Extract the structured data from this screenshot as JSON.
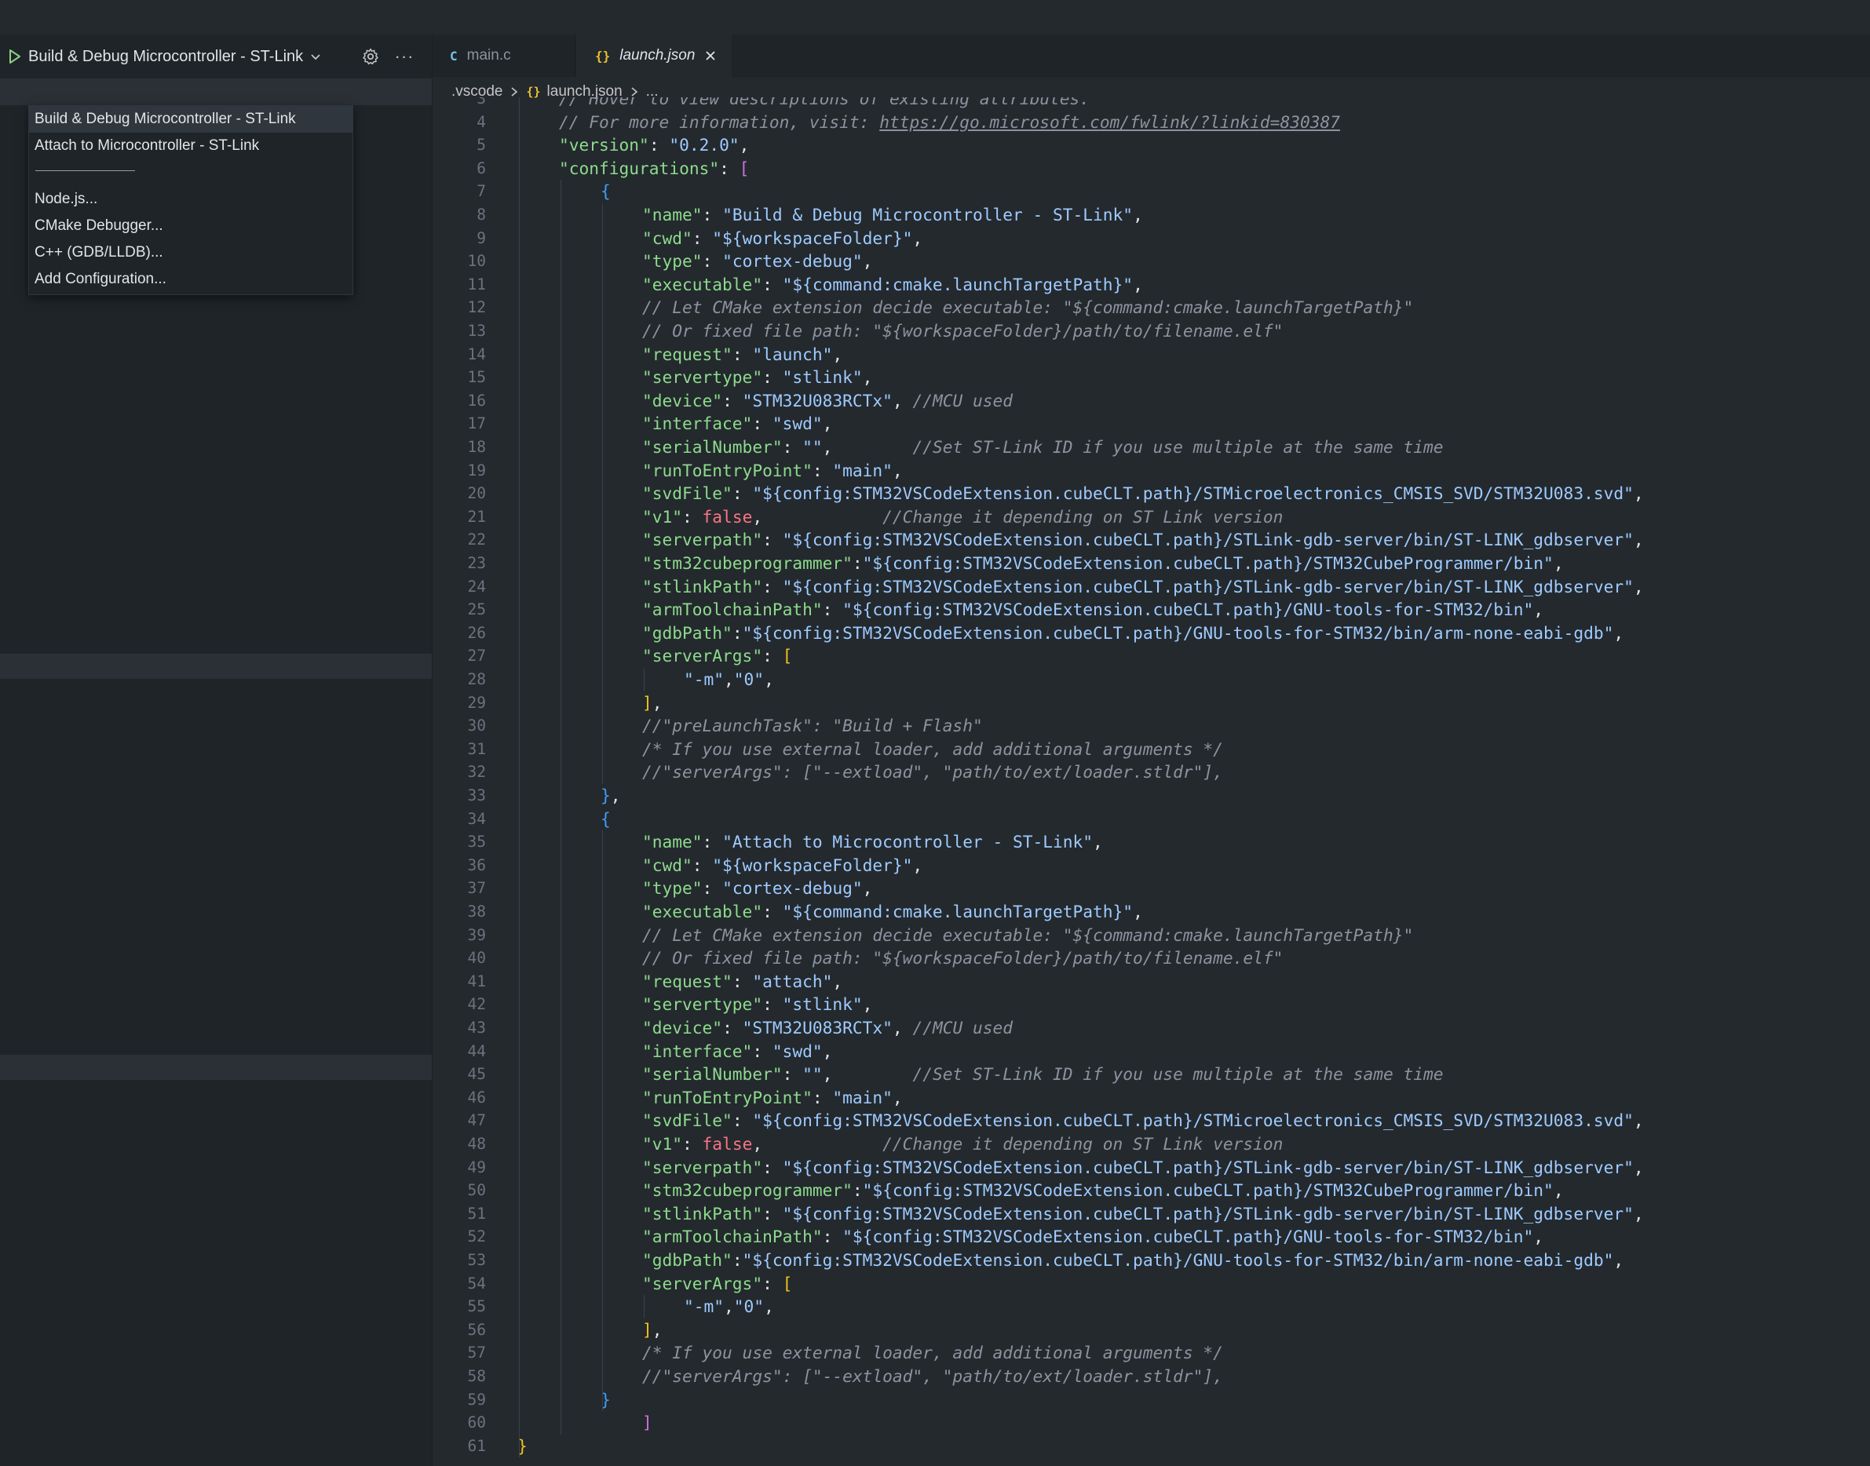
{
  "debug_toolbar": {
    "selected_config": "Build & Debug Microcontroller - ST-Link"
  },
  "config_dropdown": {
    "items": [
      "Build & Debug Microcontroller - ST-Link",
      "Attach to Microcontroller - ST-Link",
      "Node.js...",
      "CMake Debugger...",
      "C++ (GDB/LLDB)...",
      "Add Configuration..."
    ]
  },
  "tabs": [
    {
      "icon": "C",
      "label": "main.c",
      "active": false
    },
    {
      "icon": "{}",
      "label": "launch.json",
      "active": true
    }
  ],
  "breadcrumb": [
    ".vscode",
    "launch.json",
    "..."
  ],
  "breadcrumb_icon": "{}",
  "code": {
    "first_line_number": 3,
    "lines": [
      [
        [
          "c",
          "// Hover to view descriptions of existing attributes."
        ]
      ],
      [
        [
          "c",
          "// For more information, visit: "
        ],
        [
          "cu",
          "https://go.microsoft.com/fwlink/?linkid=830387"
        ]
      ],
      [
        [
          "k",
          "\"version\""
        ],
        [
          "p",
          ": "
        ],
        [
          "s",
          "\"0.2.0\""
        ],
        [
          "p",
          ","
        ]
      ],
      [
        [
          "k",
          "\"configurations\""
        ],
        [
          "p",
          ": "
        ],
        [
          "b2",
          "["
        ]
      ],
      [
        [
          "b3",
          "{"
        ]
      ],
      [
        [
          "k",
          "\"name\""
        ],
        [
          "p",
          ": "
        ],
        [
          "s",
          "\"Build & Debug Microcontroller - ST-Link\""
        ],
        [
          "p",
          ","
        ]
      ],
      [
        [
          "k",
          "\"cwd\""
        ],
        [
          "p",
          ": "
        ],
        [
          "s",
          "\"${workspaceFolder}\""
        ],
        [
          "p",
          ","
        ]
      ],
      [
        [
          "k",
          "\"type\""
        ],
        [
          "p",
          ": "
        ],
        [
          "s",
          "\"cortex-debug\""
        ],
        [
          "p",
          ","
        ]
      ],
      [
        [
          "k",
          "\"executable\""
        ],
        [
          "p",
          ": "
        ],
        [
          "s",
          "\"${command:cmake.launchTargetPath}\""
        ],
        [
          "p",
          ","
        ]
      ],
      [
        [
          "c",
          "// Let CMake extension decide executable: \"${command:cmake.launchTargetPath}\""
        ]
      ],
      [
        [
          "c",
          "// Or fixed file path: \"${workspaceFolder}/path/to/filename.elf\""
        ]
      ],
      [
        [
          "k",
          "\"request\""
        ],
        [
          "p",
          ": "
        ],
        [
          "s",
          "\"launch\""
        ],
        [
          "p",
          ","
        ]
      ],
      [
        [
          "k",
          "\"servertype\""
        ],
        [
          "p",
          ": "
        ],
        [
          "s",
          "\"stlink\""
        ],
        [
          "p",
          ","
        ]
      ],
      [
        [
          "k",
          "\"device\""
        ],
        [
          "p",
          ": "
        ],
        [
          "s",
          "\"STM32U083RCTx\""
        ],
        [
          "p",
          ", "
        ],
        [
          "c",
          "//MCU used"
        ]
      ],
      [
        [
          "k",
          "\"interface\""
        ],
        [
          "p",
          ": "
        ],
        [
          "s",
          "\"swd\""
        ],
        [
          "p",
          ","
        ]
      ],
      [
        [
          "k",
          "\"serialNumber\""
        ],
        [
          "p",
          ": "
        ],
        [
          "s",
          "\"\""
        ],
        [
          "p",
          ",        "
        ],
        [
          "c",
          "//Set ST-Link ID if you use multiple at the same time"
        ]
      ],
      [
        [
          "k",
          "\"runToEntryPoint\""
        ],
        [
          "p",
          ": "
        ],
        [
          "s",
          "\"main\""
        ],
        [
          "p",
          ","
        ]
      ],
      [
        [
          "k",
          "\"svdFile\""
        ],
        [
          "p",
          ": "
        ],
        [
          "s",
          "\"${config:STM32VSCodeExtension.cubeCLT.path}/STMicroelectronics_CMSIS_SVD/STM32U083.svd\""
        ],
        [
          "p",
          ","
        ]
      ],
      [
        [
          "k",
          "\"v1\""
        ],
        [
          "p",
          ": "
        ],
        [
          "kw",
          "false"
        ],
        [
          "p",
          ",            "
        ],
        [
          "c",
          "//Change it depending on ST Link version"
        ]
      ],
      [
        [
          "k",
          "\"serverpath\""
        ],
        [
          "p",
          ": "
        ],
        [
          "s",
          "\"${config:STM32VSCodeExtension.cubeCLT.path}/STLink-gdb-server/bin/ST-LINK_gdbserver\""
        ],
        [
          "p",
          ","
        ]
      ],
      [
        [
          "k",
          "\"stm32cubeprogrammer\""
        ],
        [
          "p",
          ":"
        ],
        [
          "s",
          "\"${config:STM32VSCodeExtension.cubeCLT.path}/STM32CubeProgrammer/bin\""
        ],
        [
          "p",
          ","
        ]
      ],
      [
        [
          "k",
          "\"stlinkPath\""
        ],
        [
          "p",
          ": "
        ],
        [
          "s",
          "\"${config:STM32VSCodeExtension.cubeCLT.path}/STLink-gdb-server/bin/ST-LINK_gdbserver\""
        ],
        [
          "p",
          ","
        ]
      ],
      [
        [
          "k",
          "\"armToolchainPath\""
        ],
        [
          "p",
          ": "
        ],
        [
          "s",
          "\"${config:STM32VSCodeExtension.cubeCLT.path}/GNU-tools-for-STM32/bin\""
        ],
        [
          "p",
          ","
        ]
      ],
      [
        [
          "k",
          "\"gdbPath\""
        ],
        [
          "p",
          ":"
        ],
        [
          "s",
          "\"${config:STM32VSCodeExtension.cubeCLT.path}/GNU-tools-for-STM32/bin/arm-none-eabi-gdb\""
        ],
        [
          "p",
          ","
        ]
      ],
      [
        [
          "k",
          "\"serverArgs\""
        ],
        [
          "p",
          ": "
        ],
        [
          "b1",
          "["
        ]
      ],
      [
        [
          "s",
          "\"-m\""
        ],
        [
          "p",
          ","
        ],
        [
          "s",
          "\"0\""
        ],
        [
          "p",
          ","
        ]
      ],
      [
        [
          "b1",
          "]"
        ],
        [
          "p",
          ","
        ]
      ],
      [
        [
          "c",
          "//\"preLaunchTask\": \"Build + Flash\""
        ]
      ],
      [
        [
          "c",
          "/* If you use external loader, add additional arguments */"
        ]
      ],
      [
        [
          "c",
          "//\"serverArgs\": [\"--extload\", \"path/to/ext/loader.stldr\"],"
        ]
      ],
      [
        [
          "b3",
          "}"
        ],
        [
          "p",
          ","
        ]
      ],
      [
        [
          "b3",
          "{"
        ]
      ],
      [
        [
          "k",
          "\"name\""
        ],
        [
          "p",
          ": "
        ],
        [
          "s",
          "\"Attach to Microcontroller - ST-Link\""
        ],
        [
          "p",
          ","
        ]
      ],
      [
        [
          "k",
          "\"cwd\""
        ],
        [
          "p",
          ": "
        ],
        [
          "s",
          "\"${workspaceFolder}\""
        ],
        [
          "p",
          ","
        ]
      ],
      [
        [
          "k",
          "\"type\""
        ],
        [
          "p",
          ": "
        ],
        [
          "s",
          "\"cortex-debug\""
        ],
        [
          "p",
          ","
        ]
      ],
      [
        [
          "k",
          "\"executable\""
        ],
        [
          "p",
          ": "
        ],
        [
          "s",
          "\"${command:cmake.launchTargetPath}\""
        ],
        [
          "p",
          ","
        ]
      ],
      [
        [
          "c",
          "// Let CMake extension decide executable: \"${command:cmake.launchTargetPath}\""
        ]
      ],
      [
        [
          "c",
          "// Or fixed file path: \"${workspaceFolder}/path/to/filename.elf\""
        ]
      ],
      [
        [
          "k",
          "\"request\""
        ],
        [
          "p",
          ": "
        ],
        [
          "s",
          "\"attach\""
        ],
        [
          "p",
          ","
        ]
      ],
      [
        [
          "k",
          "\"servertype\""
        ],
        [
          "p",
          ": "
        ],
        [
          "s",
          "\"stlink\""
        ],
        [
          "p",
          ","
        ]
      ],
      [
        [
          "k",
          "\"device\""
        ],
        [
          "p",
          ": "
        ],
        [
          "s",
          "\"STM32U083RCTx\""
        ],
        [
          "p",
          ", "
        ],
        [
          "c",
          "//MCU used"
        ]
      ],
      [
        [
          "k",
          "\"interface\""
        ],
        [
          "p",
          ": "
        ],
        [
          "s",
          "\"swd\""
        ],
        [
          "p",
          ","
        ]
      ],
      [
        [
          "k",
          "\"serialNumber\""
        ],
        [
          "p",
          ": "
        ],
        [
          "s",
          "\"\""
        ],
        [
          "p",
          ",        "
        ],
        [
          "c",
          "//Set ST-Link ID if you use multiple at the same time"
        ]
      ],
      [
        [
          "k",
          "\"runToEntryPoint\""
        ],
        [
          "p",
          ": "
        ],
        [
          "s",
          "\"main\""
        ],
        [
          "p",
          ","
        ]
      ],
      [
        [
          "k",
          "\"svdFile\""
        ],
        [
          "p",
          ": "
        ],
        [
          "s",
          "\"${config:STM32VSCodeExtension.cubeCLT.path}/STMicroelectronics_CMSIS_SVD/STM32U083.svd\""
        ],
        [
          "p",
          ","
        ]
      ],
      [
        [
          "k",
          "\"v1\""
        ],
        [
          "p",
          ": "
        ],
        [
          "kw",
          "false"
        ],
        [
          "p",
          ",            "
        ],
        [
          "c",
          "//Change it depending on ST Link version"
        ]
      ],
      [
        [
          "k",
          "\"serverpath\""
        ],
        [
          "p",
          ": "
        ],
        [
          "s",
          "\"${config:STM32VSCodeExtension.cubeCLT.path}/STLink-gdb-server/bin/ST-LINK_gdbserver\""
        ],
        [
          "p",
          ","
        ]
      ],
      [
        [
          "k",
          "\"stm32cubeprogrammer\""
        ],
        [
          "p",
          ":"
        ],
        [
          "s",
          "\"${config:STM32VSCodeExtension.cubeCLT.path}/STM32CubeProgrammer/bin\""
        ],
        [
          "p",
          ","
        ]
      ],
      [
        [
          "k",
          "\"stlinkPath\""
        ],
        [
          "p",
          ": "
        ],
        [
          "s",
          "\"${config:STM32VSCodeExtension.cubeCLT.path}/STLink-gdb-server/bin/ST-LINK_gdbserver\""
        ],
        [
          "p",
          ","
        ]
      ],
      [
        [
          "k",
          "\"armToolchainPath\""
        ],
        [
          "p",
          ": "
        ],
        [
          "s",
          "\"${config:STM32VSCodeExtension.cubeCLT.path}/GNU-tools-for-STM32/bin\""
        ],
        [
          "p",
          ","
        ]
      ],
      [
        [
          "k",
          "\"gdbPath\""
        ],
        [
          "p",
          ":"
        ],
        [
          "s",
          "\"${config:STM32VSCodeExtension.cubeCLT.path}/GNU-tools-for-STM32/bin/arm-none-eabi-gdb\""
        ],
        [
          "p",
          ","
        ]
      ],
      [
        [
          "k",
          "\"serverArgs\""
        ],
        [
          "p",
          ": "
        ],
        [
          "b1",
          "["
        ]
      ],
      [
        [
          "s",
          "\"-m\""
        ],
        [
          "p",
          ","
        ],
        [
          "s",
          "\"0\""
        ],
        [
          "p",
          ","
        ]
      ],
      [
        [
          "b1",
          "]"
        ],
        [
          "p",
          ","
        ]
      ],
      [
        [
          "c",
          "/* If you use external loader, add additional arguments */"
        ]
      ],
      [
        [
          "c",
          "//\"serverArgs\": [\"--extload\", \"path/to/ext/loader.stldr\"],"
        ]
      ],
      [
        [
          "b3",
          "}"
        ]
      ],
      [
        [
          "b2",
          "]"
        ]
      ],
      [
        [
          "b1",
          "}"
        ]
      ]
    ]
  }
}
